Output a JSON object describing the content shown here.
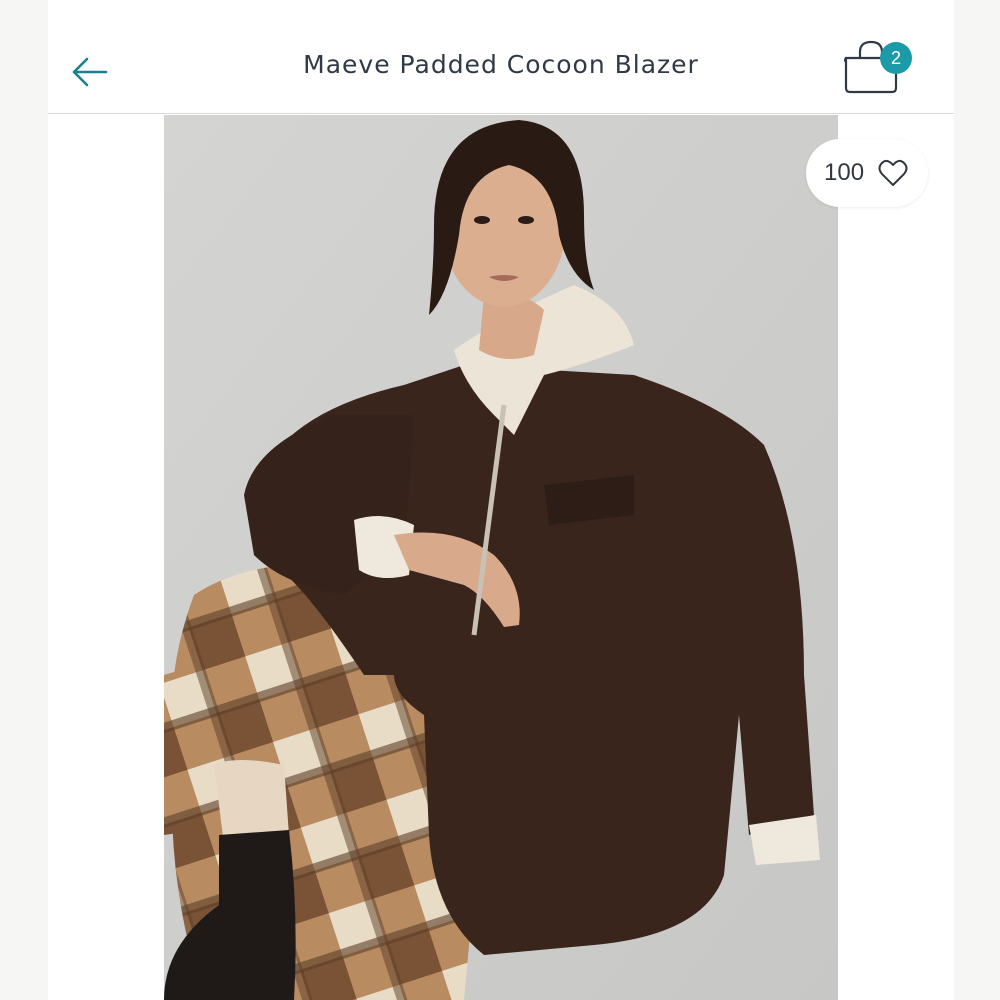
{
  "header": {
    "title": "Maeve Padded Cocoon Blazer",
    "back_icon": "arrow-left-icon",
    "cart_icon": "shopping-bag-icon",
    "cart_count": "2"
  },
  "product": {
    "image_description": "Model wearing a brown padded blazer with a cream knit collar and a plaid skirt",
    "favorites_count": "100",
    "favorite_icon": "heart-outline-icon"
  },
  "colors": {
    "accent": "#1c9aa8",
    "text": "#2f3a46",
    "jacket": "#3a251c",
    "background": "#cfcfcd"
  }
}
